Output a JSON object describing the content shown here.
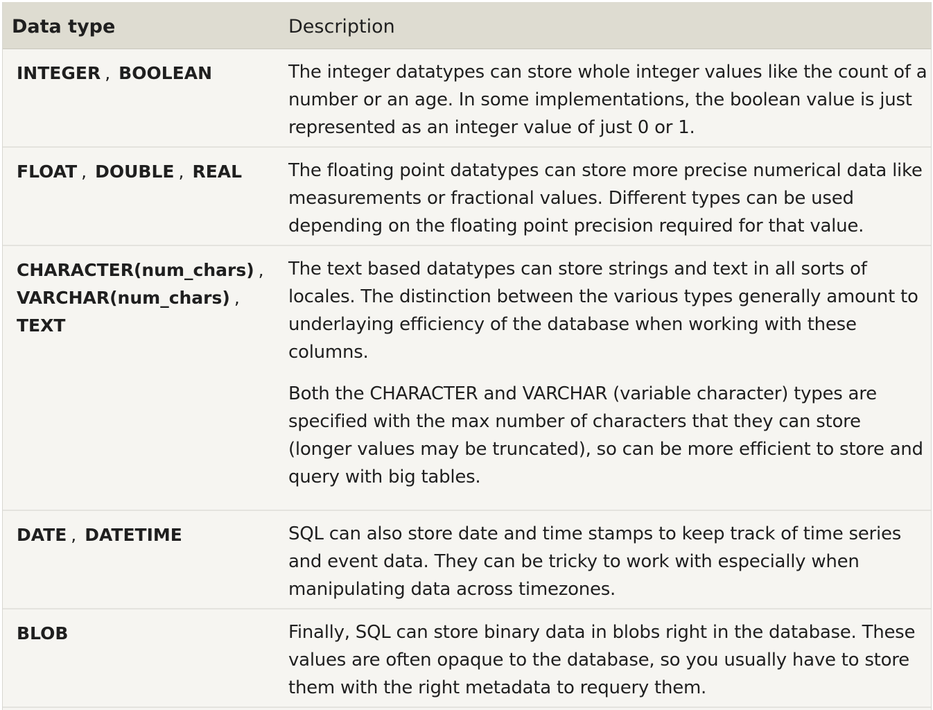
{
  "header": {
    "type_label": "Data type",
    "description_label": "Description"
  },
  "rows": [
    {
      "types": [
        [
          "INTEGER",
          ","
        ],
        [
          "BOOLEAN",
          ""
        ]
      ],
      "description": [
        "The integer datatypes can store whole integer values like the count of a number or an age. In some implementations, the boolean value is just represented as an integer value of just 0 or 1."
      ]
    },
    {
      "types": [
        [
          "FLOAT",
          ","
        ],
        [
          "DOUBLE",
          ","
        ],
        [
          "REAL",
          ""
        ]
      ],
      "description": [
        "The floating point datatypes can store more precise numerical data like measurements or fractional values. Different types can be used depending on the floating point precision required for that value."
      ]
    },
    {
      "types": [
        [
          "CHARACTER(num_chars)",
          ","
        ],
        [
          "VARCHAR(num_chars)",
          ","
        ],
        [
          "TEXT",
          ""
        ]
      ],
      "description": [
        "The text based datatypes can store strings and text in all sorts of locales. The distinction between the various types generally amount to underlaying efficiency of the database when working with these columns.",
        "Both the CHARACTER and VARCHAR (variable character) types are specified with the max number of characters that they can store (longer values may be truncated), so can be more efficient to store and query with big tables."
      ]
    },
    {
      "types": [
        [
          "DATE",
          ","
        ],
        [
          "DATETIME",
          ""
        ]
      ],
      "description": [
        "SQL can also store date and time stamps to keep track of time series and event data. They can be tricky to work with especially when manipulating data across timezones."
      ]
    },
    {
      "types": [
        [
          "BLOB",
          ""
        ]
      ],
      "description": [
        "Finally, SQL can store binary data in blobs right in the database. These values are often opaque to the database, so you usually have to store them with the right metadata to requery them."
      ]
    }
  ]
}
